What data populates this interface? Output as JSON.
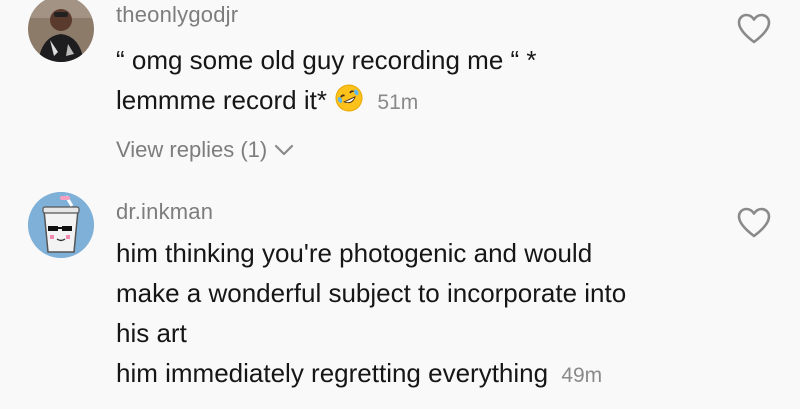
{
  "comments": [
    {
      "username": "theonlygodjr",
      "line1": "“ omg some old guy recording me “ *",
      "line2_text": "lemmme record it*",
      "timestamp": "51m",
      "view_replies": "View replies (1)"
    },
    {
      "username": "dr.inkman",
      "lines": [
        "him thinking you're photogenic and would",
        "make a wonderful subject to incorporate into",
        "his art",
        "him immediately regretting everything"
      ],
      "timestamp": "49m"
    }
  ],
  "colors": {
    "background": "#f9f9f9",
    "text": "#161616",
    "muted": "#7d7d7d"
  },
  "icons": {
    "like": "heart-outline-icon",
    "expand": "chevron-down-icon",
    "emoji": "rolling-on-floor-laughing-emoji"
  }
}
